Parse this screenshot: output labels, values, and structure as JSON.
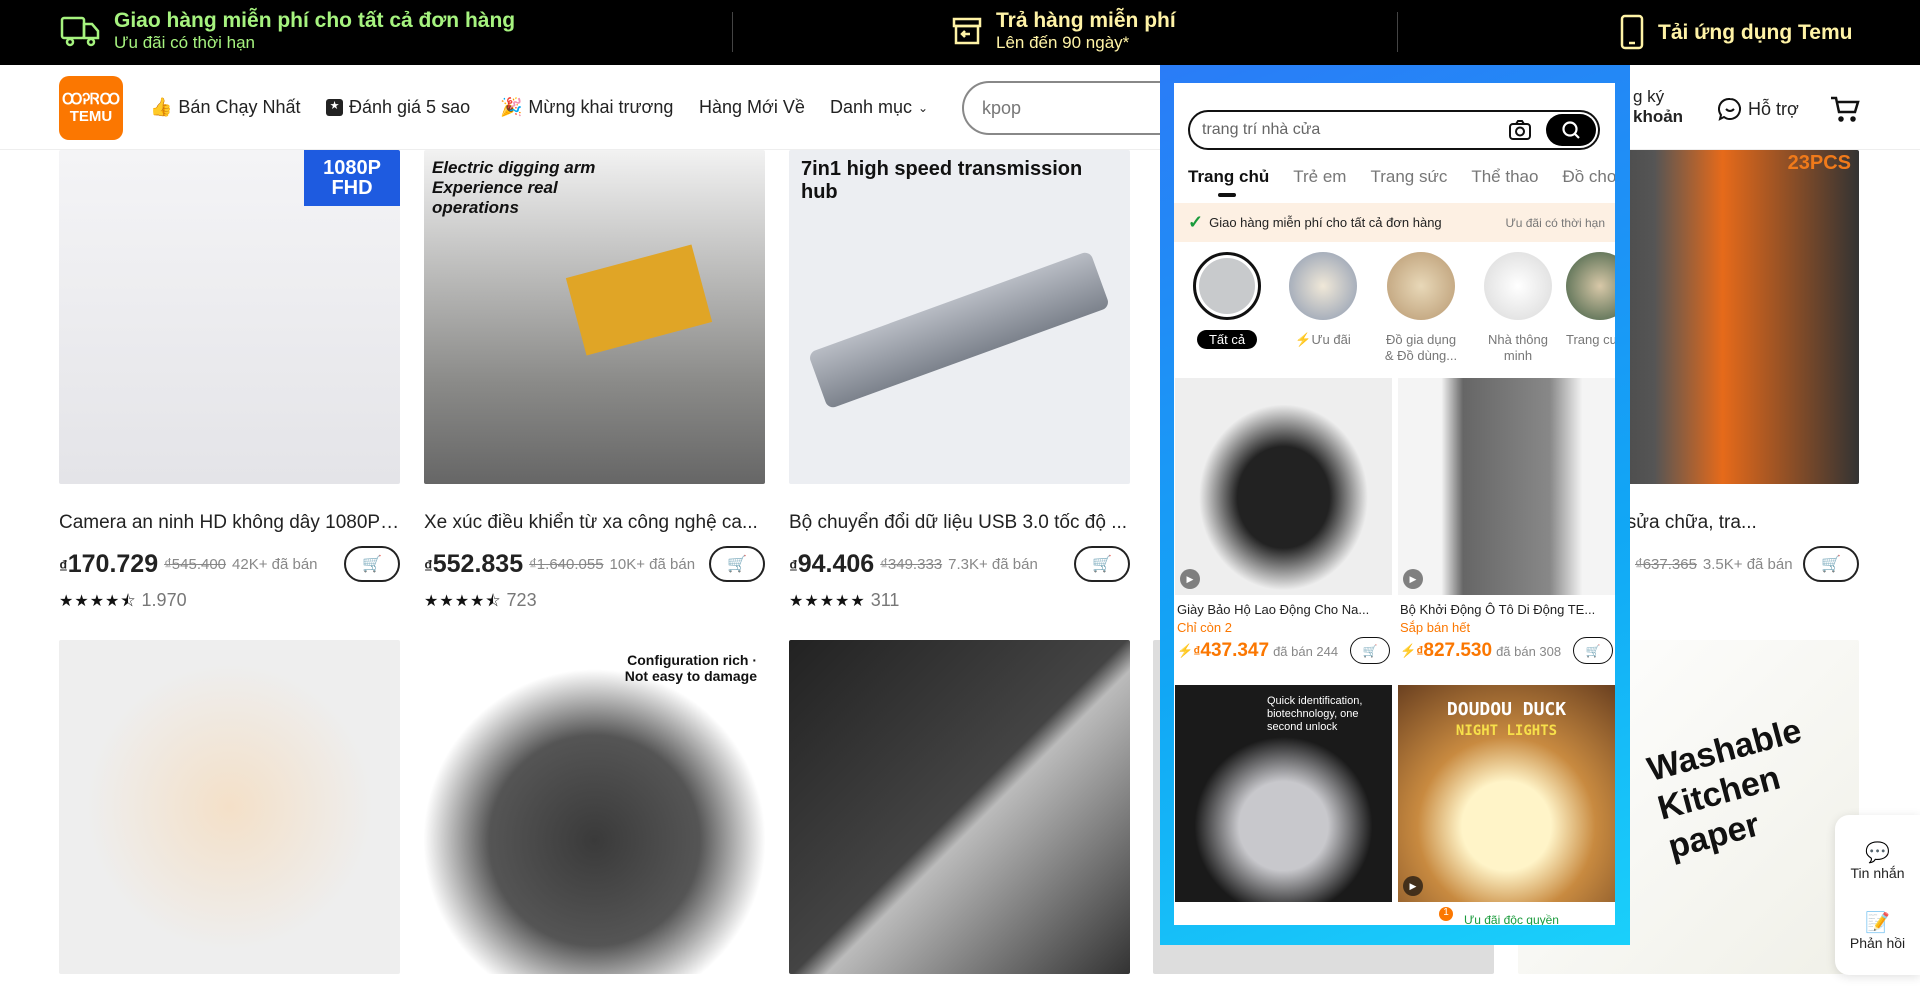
{
  "topbar": {
    "shipping": {
      "title": "Giao hàng miễn phí cho tất cả đơn hàng",
      "sub": "Ưu đãi có thời hạn",
      "icon": "truck-icon",
      "color": "#a6f37f"
    },
    "returns": {
      "title": "Trả hàng miễn phí",
      "sub": "Lên đến 90 ngày*",
      "icon": "return-box-icon",
      "color": "#fff3a6"
    },
    "app": {
      "title": "Tải ứng dụng Temu",
      "icon": "phone-icon",
      "color": "#fff3a6"
    }
  },
  "nav": {
    "logo": {
      "line1": "ꚘᎮᏒꚘ",
      "line2": "TEMU"
    },
    "items": [
      "Bán Chạy Nhất",
      "Đánh giá 5 sao",
      "Mừng khai trương",
      "Hàng Mới Về",
      "Danh mục"
    ],
    "search_value": "kpop",
    "account_line1": "g ký",
    "account_line2": "khoản",
    "support": "Hỗ trợ"
  },
  "products": [
    {
      "title": "Camera an ninh HD không dây 1080P:...",
      "price": "170.729",
      "old": "₫545.400",
      "sold": "42K+ đã bán",
      "rating_count": "1.970",
      "stars": 4.5,
      "img_caption": "1080P FHD"
    },
    {
      "title": "Xe xúc điều khiển từ xa công nghệ ca...",
      "price": "552.835",
      "old": "₫1.640.055",
      "sold": "10K+ đã bán",
      "rating_count": "723",
      "stars": 4.5,
      "img_caption": "Electric digging arm Experience real operations"
    },
    {
      "title": "Bộ chuyển đổi dữ liệu USB 3.0 tốc độ ...",
      "price": "94.406",
      "old": "₫349.333",
      "sold": "7.3K+ đã bán",
      "rating_count": "311",
      "stars": 5,
      "img_caption": "7in1 high speed transmission hub"
    },
    {
      "title": "gia đình cho sửa chữa, tra...",
      "price": "",
      "old": "₫637.365",
      "sold": "3.5K+ đã bán",
      "rating_count": "",
      "img_caption": "23PCS"
    }
  ],
  "row2_captions": [
    "",
    "Configuration rich · Not easy to damage",
    "",
    "Washable Kitchen paper"
  ],
  "currency": "₫",
  "phone": {
    "search_placeholder": "trang trí nhà cửa",
    "tabs": [
      "Trang chủ",
      "Trẻ em",
      "Trang sức",
      "Thể thao",
      "Đồ chơ"
    ],
    "banner": {
      "text": "Giao hàng miễn phí cho tất cả đơn hàng",
      "sub": "Ưu đãi có thời hạn"
    },
    "categories": [
      "Tất cả",
      "Ưu đãi",
      "Đồ gia dụng & Đồ dùng...",
      "Nhà thông minh",
      "Trang cu"
    ],
    "products": [
      {
        "title": "Giày Bảo Hộ Lao Động Cho Na...",
        "stock": "Chỉ còn 2",
        "price": "437.347",
        "sold": "đã bán 244"
      },
      {
        "title": "Bộ Khởi Động Ô Tô Di Động TE...",
        "stock": "Sắp bán hết",
        "price": "827.530",
        "sold": "đã bán 308"
      }
    ],
    "row2_captions": [
      "Quick identification, biotechnology, one second unlock",
      "DOUDOU DUCK",
      "NIGHT LIGHTS"
    ],
    "bottom_nav_text": "Ưu đãi độc quyền",
    "cart_badge": "1"
  },
  "side": {
    "messages": "Tin nhắn",
    "feedback": "Phản hồi"
  },
  "colors": {
    "brand": "#fb7701",
    "frame": "#1a9bf7"
  }
}
